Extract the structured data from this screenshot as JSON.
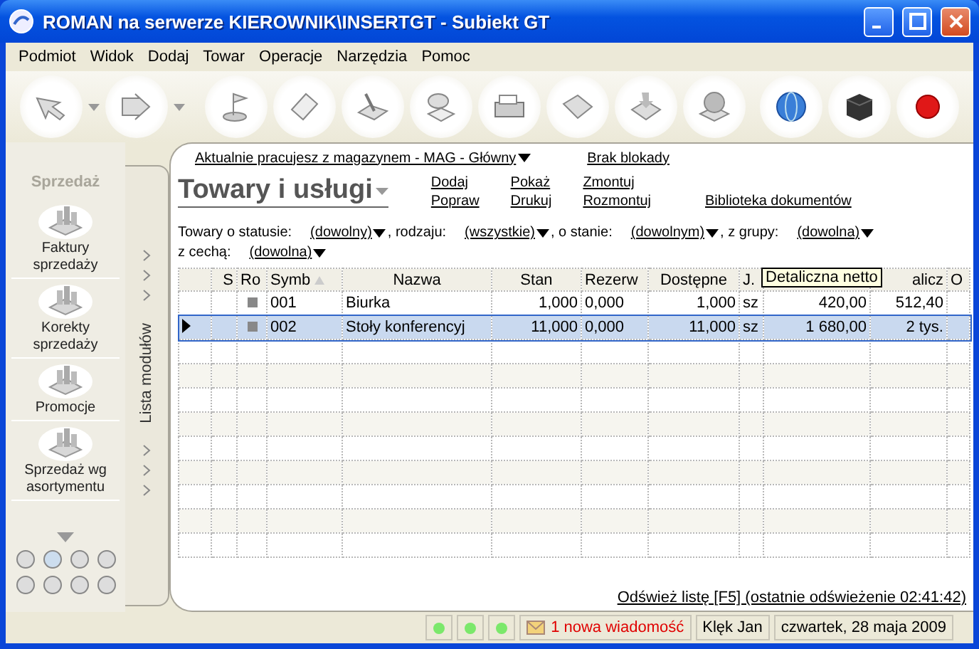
{
  "window": {
    "title": "ROMAN na serwerze KIEROWNIK\\INSERTGT - Subiekt GT"
  },
  "menu": [
    "Podmiot",
    "Widok",
    "Dodaj",
    "Towar",
    "Operacje",
    "Narzędzia",
    "Pomoc"
  ],
  "sidebar": {
    "title": "Sprzedaż",
    "tab_label": "Lista modułów",
    "modules": [
      {
        "label": "Faktury sprzedaży"
      },
      {
        "label": "Korekty sprzedaży"
      },
      {
        "label": "Promocje"
      },
      {
        "label": "Sprzedaż wg asortymentu"
      }
    ]
  },
  "warehouse": {
    "label": "Aktualnie pracujesz z magazynem - MAG - Główny",
    "lock": "Brak blokady"
  },
  "view_title": "Towary i usługi",
  "actions": [
    [
      "Dodaj",
      "Popraw"
    ],
    [
      "Pokaż",
      "Drukuj"
    ],
    [
      "Zmontuj",
      "Rozmontuj"
    ],
    [
      "Biblioteka dokumentów"
    ]
  ],
  "filters": [
    [
      {
        "label": "Towary o statusie:",
        "value": "(dowolny)"
      },
      {
        "label": ", rodzaju:",
        "value": "(wszystkie)"
      },
      {
        "label": ", o stanie:",
        "value": "(dowolnym)"
      },
      {
        "label": ", z grupy:",
        "value": "(dowolna)"
      }
    ],
    [
      {
        "label": "z cechą:",
        "value": "(dowolna)"
      }
    ]
  ],
  "table": {
    "columns": [
      {
        "sorted": false
      },
      {
        "header": "S",
        "sorted": false
      },
      {
        "header": "Ro",
        "sorted": false
      },
      {
        "header": "Symb",
        "sorted": true
      },
      {
        "header": "Nazwa",
        "sorted": false
      },
      {
        "header": "Stan",
        "sorted": false
      },
      {
        "header": "Rezerw",
        "sorted": false
      },
      {
        "header": "Dostępne",
        "sorted": false
      },
      {
        "header": "J.",
        "sorted": false
      },
      {
        "sorted": false
      },
      {
        "header": "alicz",
        "sorted": false
      },
      {
        "header": "O",
        "sorted": false
      }
    ],
    "tooltip": "Detaliczna netto",
    "rows": [
      {
        "selected": false,
        "cells": [
          "",
          "",
          "",
          "001",
          "Biurka",
          "1,000",
          "0,000",
          "1,000",
          "sz",
          "420,00",
          "512,40",
          ""
        ]
      },
      {
        "selected": true,
        "cells": [
          "",
          "",
          "",
          "002",
          "Stoły konferencyj",
          "11,000",
          "0,000",
          "11,000",
          "sz",
          "1 680,00",
          "2 tys.",
          ""
        ]
      }
    ]
  },
  "refresh": "Odśwież listę [F5] (ostatnie odświeżenie 02:41:42)",
  "status_bar": {
    "message": "1 nowa wiadomość",
    "user": "Klęk Jan",
    "date": "czwartek, 28 maja 2009"
  }
}
